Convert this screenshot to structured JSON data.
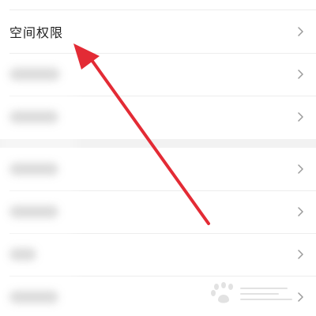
{
  "settings_list": {
    "items": [
      {
        "label": "空间权限"
      },
      {
        "label": ""
      },
      {
        "label": ""
      },
      {
        "label": ""
      },
      {
        "label": ""
      },
      {
        "label": ""
      },
      {
        "label": ""
      }
    ]
  },
  "annotation": {
    "arrow_color": "#e32b35"
  },
  "watermark": {
    "icon": "baidu-paw-logo",
    "color": "#9b9b9b"
  }
}
